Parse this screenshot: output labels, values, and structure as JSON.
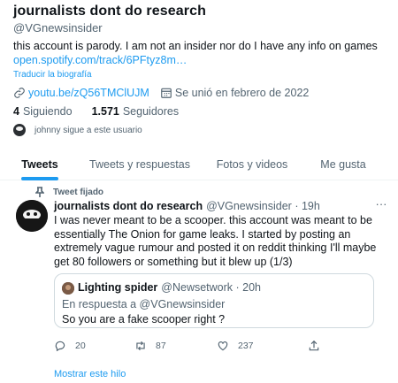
{
  "profile": {
    "name": "journalists dont do research",
    "handle": "@VGnewsinsider",
    "bio": "this account is parody. I am not an insider nor do I have any info on games",
    "bio_link": "open.spotify.com/track/6PFtyz8m…",
    "translate": "Traducir la biografía",
    "link": "youtu.be/zQ56TMClUJM",
    "joined": "Se unió en febrero de 2022",
    "following_count": "4",
    "following_label": "Siguiendo",
    "followers_count": "1.571",
    "followers_label": "Seguidores",
    "followed_by": "johnny sigue a este usuario"
  },
  "tabs": [
    "Tweets",
    "Tweets y respuestas",
    "Fotos y videos",
    "Me gusta"
  ],
  "tweet": {
    "pinned_label": "Tweet fijado",
    "author": "journalists dont do research",
    "handle_time": "@VGnewsinsider · 19h",
    "text": "I was never meant to be a scooper. this account was meant to be essentially The Onion for game leaks. I started by posting an extremely vague rumour and posted it on reddit thinking I'll maybe get 80 followers or something but it blew up (1/3)",
    "quote": {
      "author": "Lighting spider",
      "handle_time": "@Newsetwork · 20h",
      "reply_to": "En respuesta a @VGnewsinsider",
      "text": "So you are a fake scooper right ?"
    },
    "replies": "20",
    "retweets": "87",
    "likes": "237",
    "show_thread": "Mostrar este hilo"
  },
  "colors": {
    "accent": "#1d9bf0",
    "text": "#0f1419",
    "secondary": "#536471",
    "border": "#cfd9de"
  }
}
